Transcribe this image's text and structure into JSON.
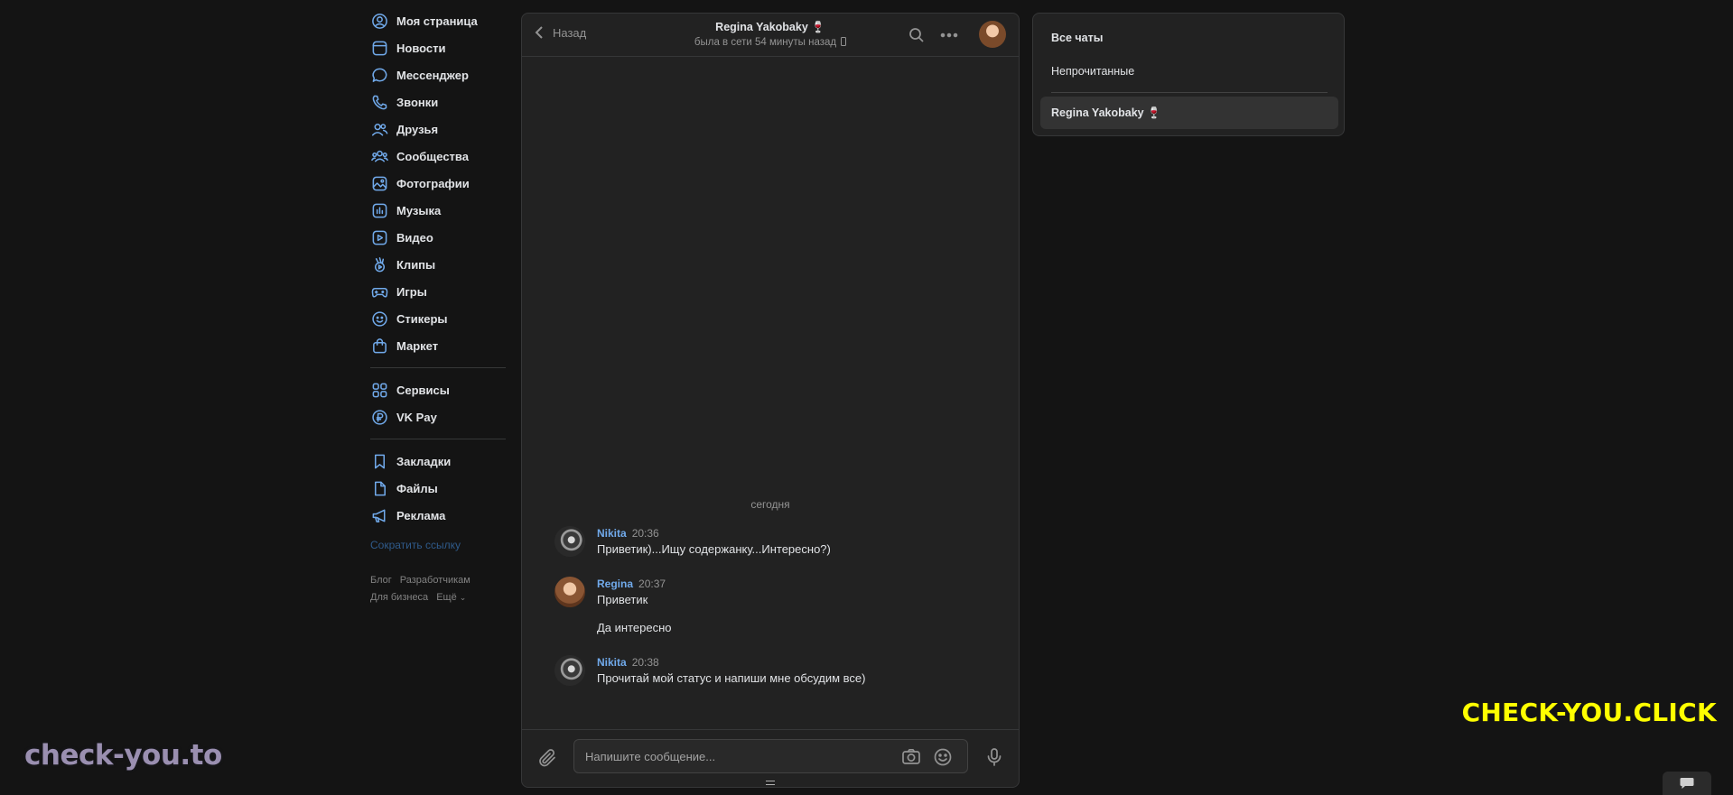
{
  "nav": {
    "items": [
      {
        "label": "Моя страница",
        "icon": "profile-icon"
      },
      {
        "label": "Новости",
        "icon": "news-icon"
      },
      {
        "label": "Мессенджер",
        "icon": "messenger-icon"
      },
      {
        "label": "Звонки",
        "icon": "phone-icon"
      },
      {
        "label": "Друзья",
        "icon": "friends-icon"
      },
      {
        "label": "Сообщества",
        "icon": "communities-icon"
      },
      {
        "label": "Фотографии",
        "icon": "photos-icon"
      },
      {
        "label": "Музыка",
        "icon": "music-icon"
      },
      {
        "label": "Видео",
        "icon": "video-icon"
      },
      {
        "label": "Клипы",
        "icon": "clips-icon"
      },
      {
        "label": "Игры",
        "icon": "games-icon"
      },
      {
        "label": "Стикеры",
        "icon": "stickers-icon"
      },
      {
        "label": "Маркет",
        "icon": "market-icon"
      }
    ],
    "items2": [
      {
        "label": "Сервисы",
        "icon": "services-icon"
      },
      {
        "label": "VK Pay",
        "icon": "vkpay-icon"
      }
    ],
    "items3": [
      {
        "label": "Закладки",
        "icon": "bookmarks-icon"
      },
      {
        "label": "Файлы",
        "icon": "files-icon"
      },
      {
        "label": "Реклама",
        "icon": "ads-icon"
      }
    ],
    "shorten_link": "Сократить ссылку",
    "footer": {
      "blog": "Блог",
      "developers": "Разработчикам",
      "business": "Для бизнеса",
      "more": "Ещё"
    }
  },
  "chat": {
    "back_label": "Назад",
    "peer_name": "Regina Yakobaky 🍷",
    "peer_status": "была в сети 54 минуты назад",
    "day_label": "сегодня",
    "messages": [
      {
        "author": "Nikita",
        "time": "20:36",
        "texts": [
          "Приветик)...Ищу содержанку...Интересно?)"
        ]
      },
      {
        "author": "Regina",
        "time": "20:37",
        "texts": [
          "Приветик",
          "Да интересно"
        ]
      },
      {
        "author": "Nikita",
        "time": "20:38",
        "texts": [
          "Прочитай мой статус и напиши мне обсудим все)"
        ]
      }
    ],
    "composer_placeholder": "Напишите сообщение..."
  },
  "folders": {
    "all_chats": "Все чаты",
    "unread": "Непрочитанные",
    "active_chat": "Regina Yakobaky 🍷"
  },
  "watermarks": {
    "left": "check-you.to",
    "right": "CHECK-YOU.CLICK"
  },
  "colors": {
    "background": "#141414",
    "panel": "#222222",
    "accent": "#71aaeb",
    "watermark_right": "#ffff00",
    "watermark_left": "#9a8fb0"
  }
}
